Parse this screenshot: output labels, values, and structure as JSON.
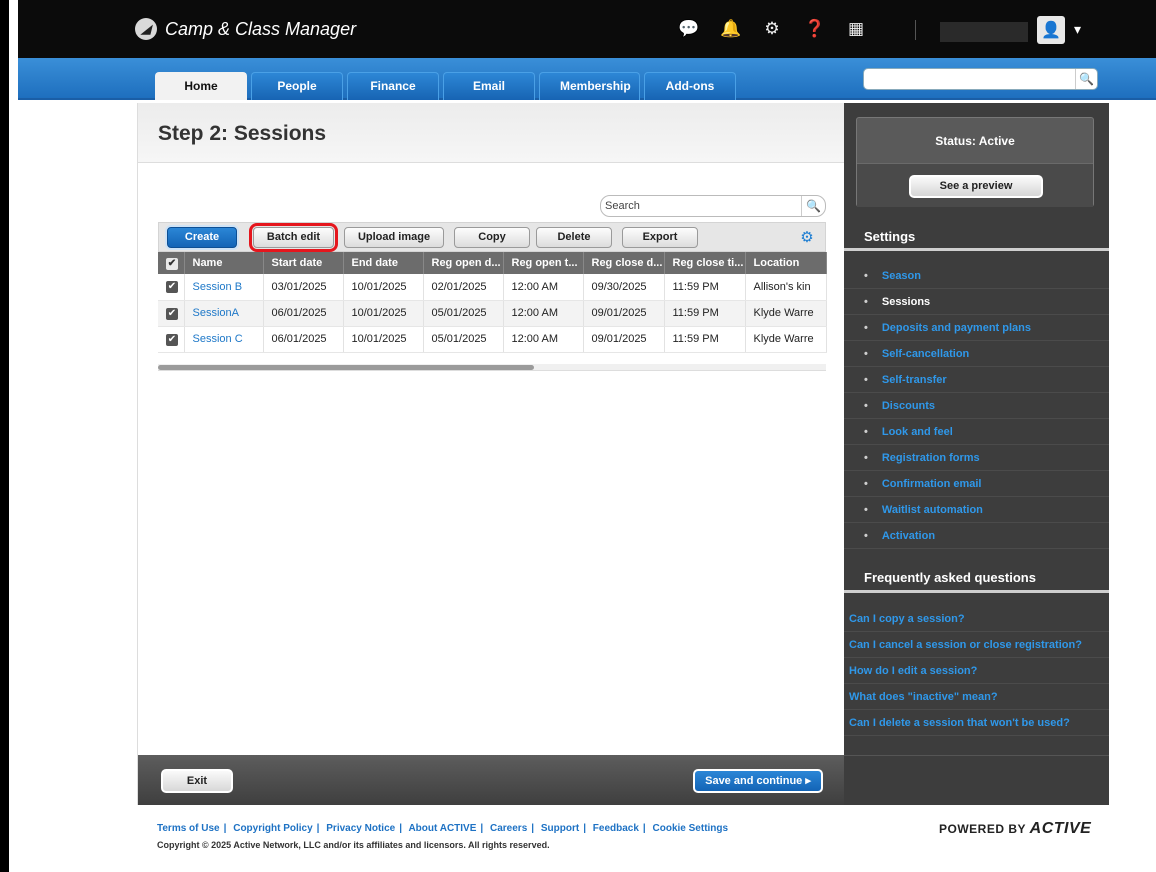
{
  "app": {
    "title": "Camp & Class Manager"
  },
  "topbar": {
    "icons": [
      "chat-icon",
      "bell-icon",
      "gear-icon",
      "help-icon",
      "apps-grid-icon"
    ],
    "user_menu_caret": "▾"
  },
  "nav": {
    "tabs": [
      {
        "label": "Home",
        "active": true
      },
      {
        "label": "People"
      },
      {
        "label": "Finance"
      },
      {
        "label": "Email"
      },
      {
        "label": "Membership"
      },
      {
        "label": "Add-ons"
      }
    ],
    "search_placeholder": ""
  },
  "page": {
    "title": "Step 2: Sessions",
    "search_placeholder": "Search"
  },
  "toolbar": {
    "create": "Create",
    "batch_edit": "Batch edit",
    "upload_image": "Upload image",
    "copy": "Copy",
    "delete": "Delete",
    "export": "Export"
  },
  "table": {
    "columns": [
      "Name",
      "Start date",
      "End date",
      "Reg open d...",
      "Reg open t...",
      "Reg close d...",
      "Reg close ti...",
      "Location"
    ],
    "rows": [
      {
        "name": "Session B",
        "start": "03/01/2025",
        "end": "10/01/2025",
        "reg_open_date": "02/01/2025",
        "reg_open_time": "12:00 AM",
        "reg_close_date": "09/30/2025",
        "reg_close_time": "11:59 PM",
        "location": "Allison's kin",
        "checked": true
      },
      {
        "name": "SessionA",
        "start": "06/01/2025",
        "end": "10/01/2025",
        "reg_open_date": "05/01/2025",
        "reg_open_time": "12:00 AM",
        "reg_close_date": "09/01/2025",
        "reg_close_time": "11:59 PM",
        "location": "Klyde Warre",
        "checked": true
      },
      {
        "name": "Session C",
        "start": "06/01/2025",
        "end": "10/01/2025",
        "reg_open_date": "05/01/2025",
        "reg_open_time": "12:00 AM",
        "reg_close_date": "09/01/2025",
        "reg_close_time": "11:59 PM",
        "location": "Klyde Warre",
        "checked": true
      }
    ]
  },
  "footer_actions": {
    "exit": "Exit",
    "save": "Save and continue ▸"
  },
  "sidebar": {
    "status": "Status: Active",
    "preview": "See a preview",
    "settings_heading": "Settings",
    "settings": [
      {
        "label": "Season"
      },
      {
        "label": "Sessions",
        "current": true
      },
      {
        "label": "Deposits and payment plans"
      },
      {
        "label": "Self-cancellation"
      },
      {
        "label": "Self-transfer"
      },
      {
        "label": "Discounts"
      },
      {
        "label": "Look and feel"
      },
      {
        "label": "Registration forms"
      },
      {
        "label": "Confirmation email"
      },
      {
        "label": "Waitlist automation"
      },
      {
        "label": "Activation"
      }
    ],
    "faq_heading": "Frequently asked questions",
    "faq": [
      "Can I copy a session?",
      "Can I cancel a session or close registration?",
      "How do I edit a session?",
      "What does \"inactive\" mean?",
      "Can I delete a session that won't be used?"
    ]
  },
  "footer": {
    "links": [
      "Terms of Use",
      "Copyright Policy",
      "Privacy Notice",
      "About ACTIVE",
      "Careers",
      "Support",
      "Feedback",
      "Cookie Settings"
    ],
    "copyright": "Copyright © 2025 Active Network, LLC and/or its affiliates and licensors. All rights reserved.",
    "powered_by": "POWERED BY",
    "powered_brand": "ACTIVE"
  },
  "colors": {
    "accent": "#1e78c8",
    "highlight_outline": "#e5161d",
    "sidebar_bg": "#3d3d3d"
  }
}
